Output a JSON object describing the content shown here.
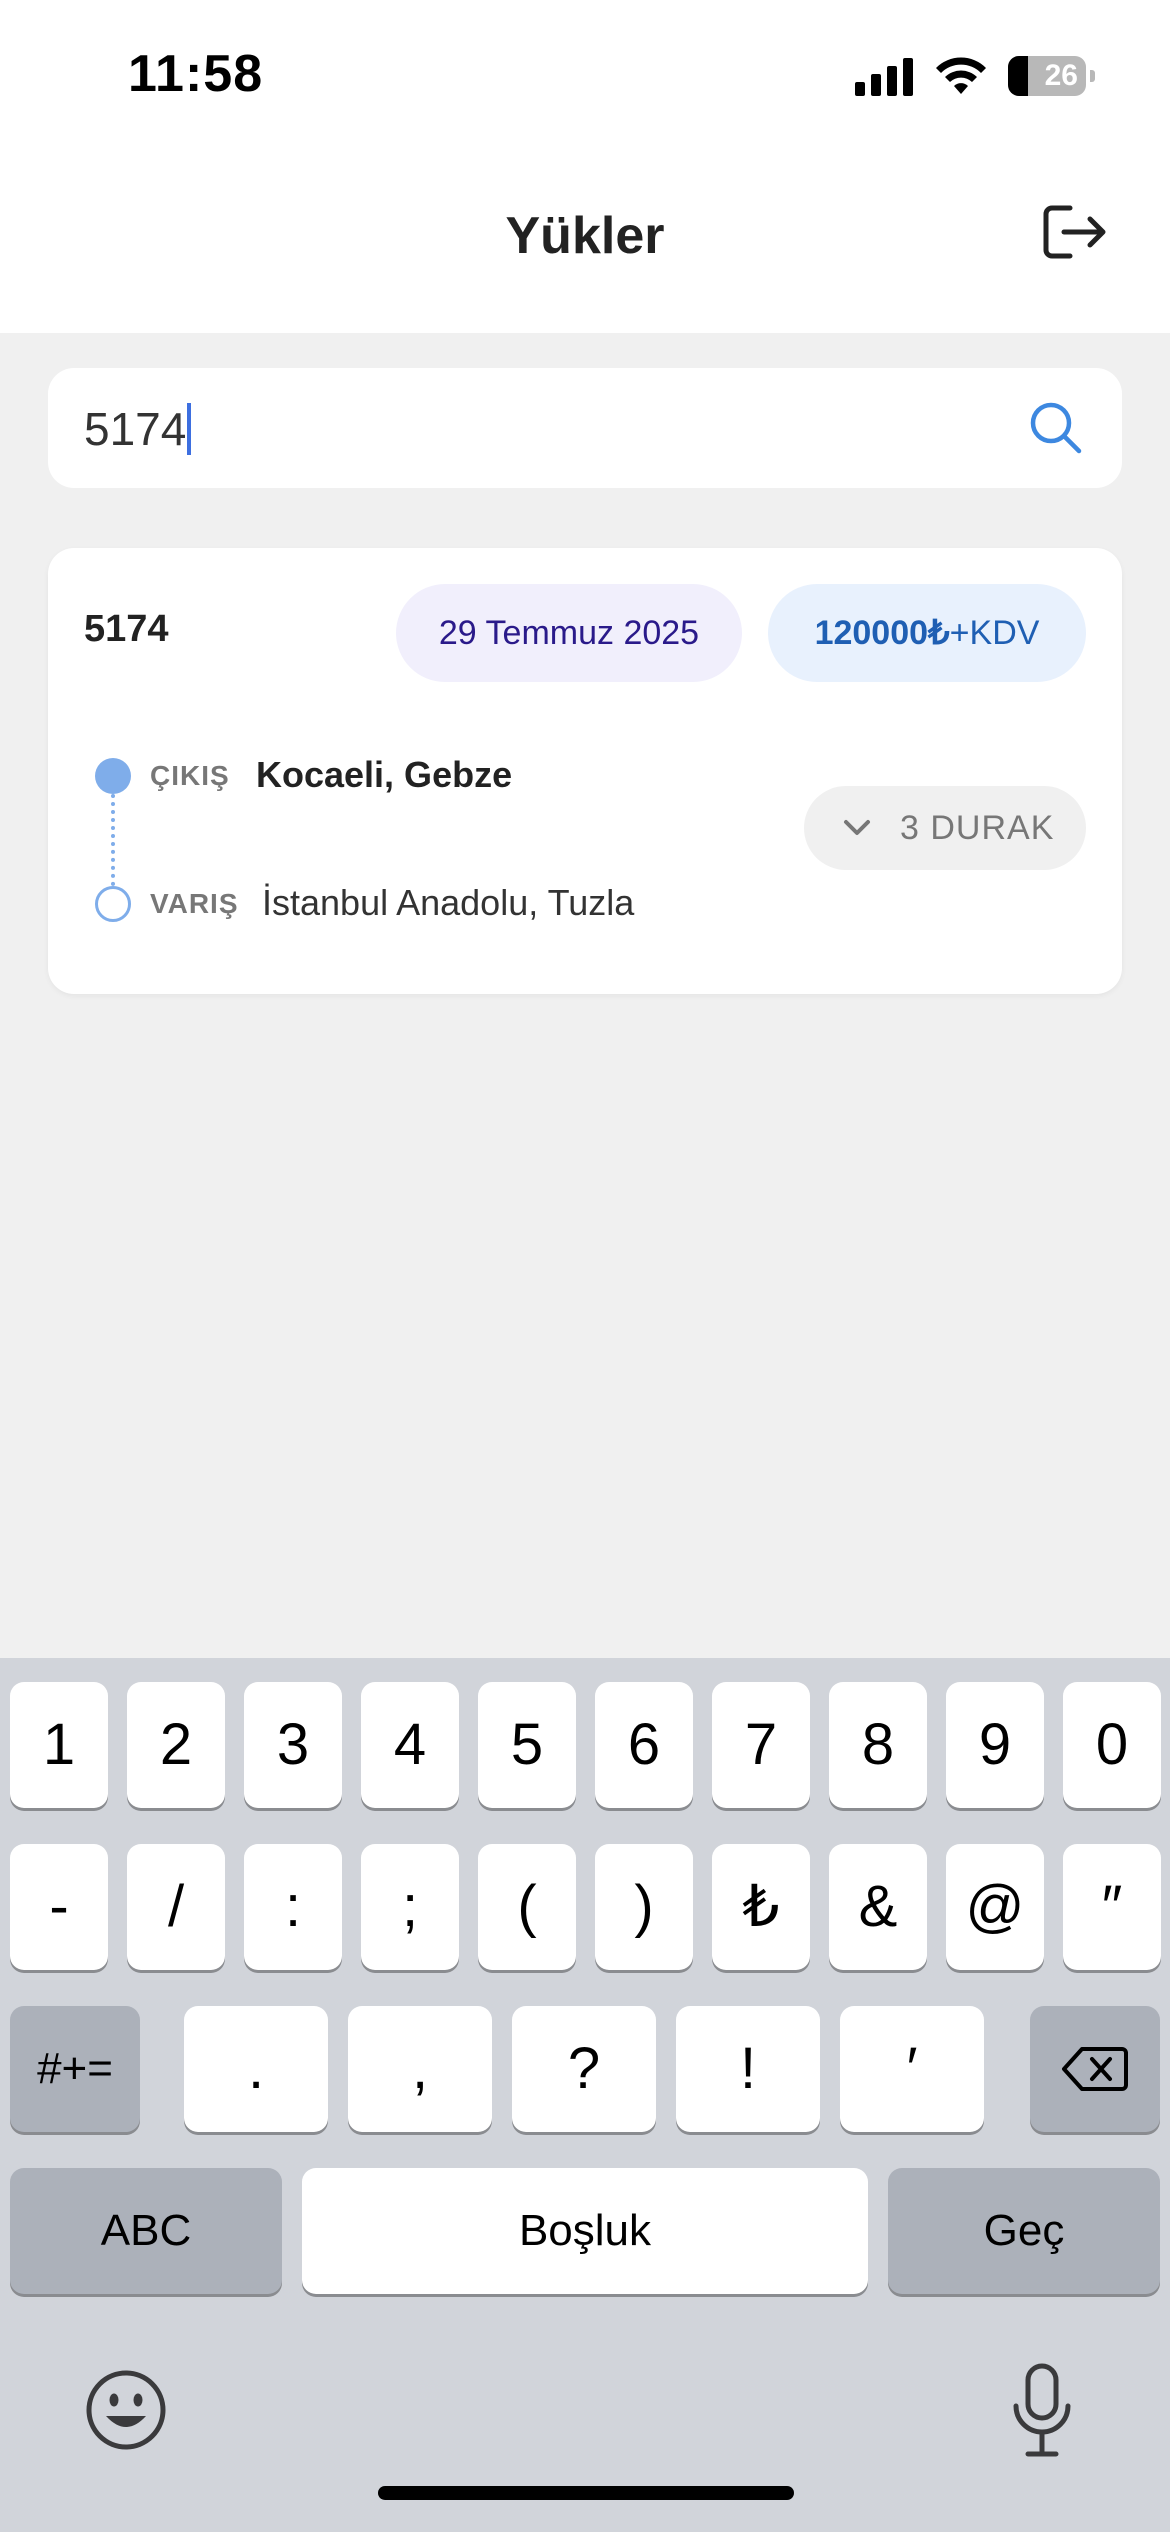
{
  "status_bar": {
    "time": "11:58",
    "battery_level": "26",
    "battery_fraction": 0.26
  },
  "header": {
    "title": "Yükler",
    "logout_icon": "logout-icon"
  },
  "search": {
    "value": "5174",
    "icon": "search-icon",
    "accent_color": "#3d88e0"
  },
  "load_card": {
    "id": "5174",
    "date": "29 Temmuz 2025",
    "price_amount": "120000₺",
    "price_suffix": "+KDV",
    "origin_label": "ÇIKIŞ",
    "origin": "Kocaeli, Gebze",
    "destination_label": "VARIŞ",
    "destination": "İstanbul Anadolu, Tuzla",
    "stops_label": "3 DURAK",
    "stops_icon": "chevron-down-icon",
    "route_color": "#7fadea",
    "date_badge_color": "#f1effc",
    "price_badge_color": "#e8f1fd"
  },
  "keyboard": {
    "row1": [
      "1",
      "2",
      "3",
      "4",
      "5",
      "6",
      "7",
      "8",
      "9",
      "0"
    ],
    "row2": [
      "-",
      "/",
      ":",
      ";",
      "(",
      ")",
      "₺",
      "&",
      "@",
      "″"
    ],
    "row3": [
      ".",
      ",",
      "?",
      "!",
      "′"
    ],
    "symbols_key": "#+=",
    "abc_key": "ABC",
    "space_key": "Boşluk",
    "return_key": "Geç",
    "delete_icon": "backspace-icon",
    "emoji_icon": "emoji-icon",
    "mic_icon": "microphone-icon"
  }
}
